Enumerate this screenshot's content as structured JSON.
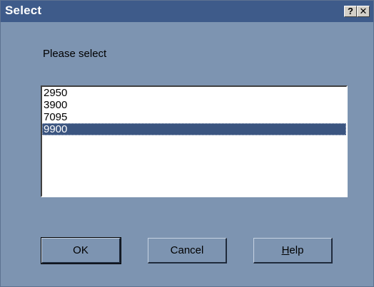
{
  "window": {
    "title": "Select",
    "help_glyph": "?",
    "close_glyph": "✕"
  },
  "prompt": "Please select",
  "list": {
    "items": [
      "2950",
      "3900",
      "7095",
      "9900"
    ],
    "selected": "9900"
  },
  "buttons": {
    "ok": "OK",
    "cancel": "Cancel",
    "help_mnemonic": "H",
    "help_rest": "elp"
  },
  "colors": {
    "dialog_bg": "#7d94b1",
    "titlebar": "#3e5b8a",
    "selection": "#3b5580"
  }
}
